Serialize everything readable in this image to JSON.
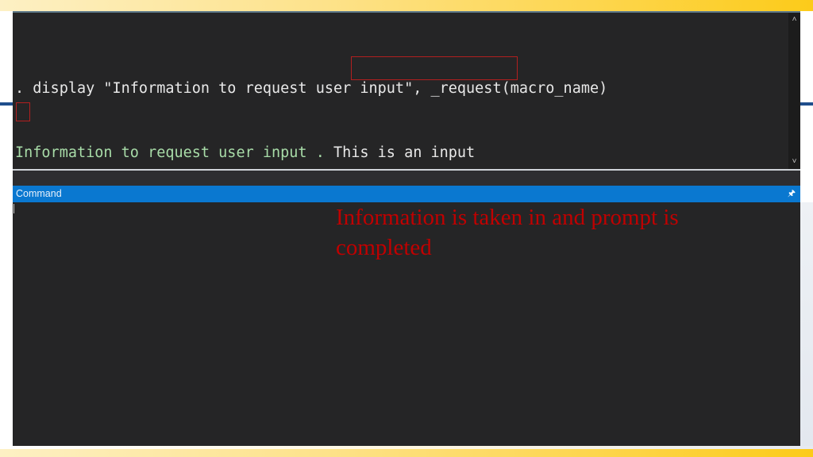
{
  "results_window": {
    "lines": [
      {
        "kind": "command",
        "text": ". display \"Information to request user input\", _request(macro_name)"
      },
      {
        "kind": "output",
        "prompt_text": "Information to request user input .",
        "user_input": "This is an input"
      },
      {
        "kind": "blank",
        "text": ""
      },
      {
        "kind": "prompt",
        "text": "."
      }
    ],
    "scroll_up_icon": "chevron-up",
    "scroll_down_icon": "chevron-down"
  },
  "command_panel": {
    "title": "Command",
    "pin_icon": "pin",
    "input_value": ""
  },
  "annotation": {
    "text": "Information is taken in and prompt is completed",
    "color": "#c00000"
  },
  "colors": {
    "header_blue": "#0a78d0",
    "output_green": "#a8dca8",
    "highlight_red": "#b21f1f",
    "pane_bg": "#252526"
  }
}
